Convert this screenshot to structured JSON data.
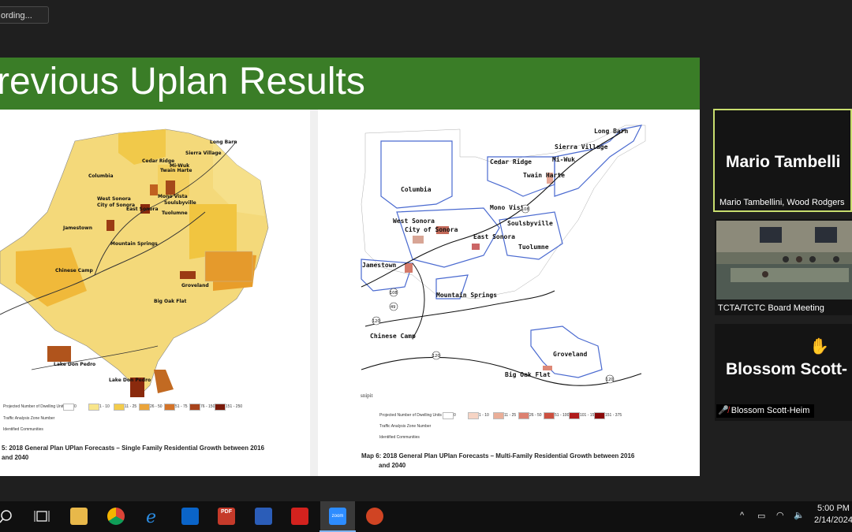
{
  "recording": {
    "label": "ording..."
  },
  "slide": {
    "title": "revious Uplan Results",
    "left_map": {
      "caption_line1": "5: 2018 General Plan UPlan Forecasts – Single Family Residential Growth between 2016",
      "caption_line2": "and 2040",
      "legend_title": "Projected Number of Dwelling Units",
      "legend_bins": [
        "0",
        "1 - 10",
        "11 - 25",
        "26 - 50",
        "51 - 75",
        "76 - 150",
        "151 - 250"
      ],
      "legend_taz": "Traffic Analysis Zone Number",
      "legend_communities": "Identified Communities",
      "places": [
        "Long Barn",
        "Sierra Village",
        "Cedar Ridge",
        "Mi-Wuk",
        "Twain Harte",
        "Columbia",
        "Mono Vista",
        "West Sonora",
        "City of Sonora",
        "Soulsbyville",
        "East Sonora",
        "Tuolumne",
        "Jamestown",
        "Mountain Springs",
        "Chinese Camp",
        "Groveland",
        "Big Oak Flat",
        "Lake Don Pedro",
        "Lake Don Pedro"
      ]
    },
    "right_map": {
      "caption_line1": "Map 6: 2018 General Plan UPlan Forecasts – Multi-Family Residential Growth between 2016",
      "caption_line2": "and 2040",
      "snip": "snipit",
      "legend_title": "Projected Number of Dwelling Units",
      "legend_bins": [
        "0",
        "1 - 10",
        "11 - 25",
        "26 - 50",
        "51 - 100",
        "101 - 150",
        "151 - 375"
      ],
      "legend_taz": "Traffic Analysis Zone Number",
      "legend_communities": "Identified Communities",
      "places": [
        "Long Barn",
        "Sierra Village",
        "Cedar Ridge",
        "Mi-Wuk",
        "Twain Harte",
        "Columbia",
        "Mono Vista",
        "West Sonora",
        "City of Sonora",
        "Soulsbyville",
        "East Sonora",
        "Tuolumne",
        "Jamestown",
        "Mountain Springs",
        "Chinese Camp",
        "Groveland",
        "Big Oak Flat"
      ],
      "highways": [
        "108",
        "49",
        "120",
        "120",
        "120",
        "108"
      ]
    }
  },
  "participants": [
    {
      "name": "Mario  Tambelli",
      "label": "Mario Tambellini, Wood Rodgers"
    },
    {
      "name": "",
      "label": "TCTA/TCTC Board Meeting"
    },
    {
      "name": "Blossom  Scott-",
      "label": "Blossom Scott-Heim"
    }
  ],
  "taskbar": {
    "apps": [
      "search-icon",
      "task-view-icon",
      "file-explorer-icon",
      "chrome-icon",
      "edge-icon",
      "outlook-icon",
      "pdf-icon",
      "word-icon",
      "acrobat-icon",
      "zoom-icon",
      "powerpoint-icon"
    ],
    "zoom_label": "zoom",
    "pdf_label": "PDF",
    "time": "5:00 PM",
    "date": "2/14/2024"
  },
  "colors": {
    "banner": "#3a7d27",
    "active_speaker": "#c8dd6e",
    "taskbar": "#101010"
  }
}
